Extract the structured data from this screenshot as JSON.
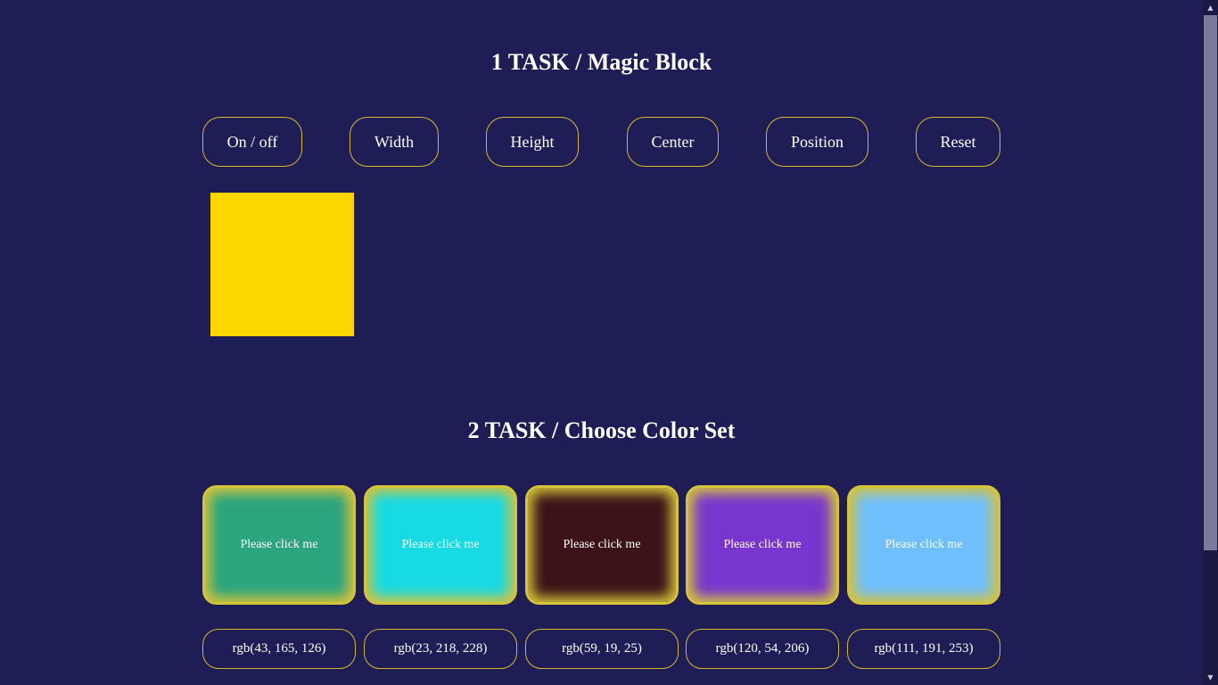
{
  "task1": {
    "title": "1 TASK / Magic Block",
    "buttons": [
      {
        "label": "On / off"
      },
      {
        "label": "Width"
      },
      {
        "label": "Height"
      },
      {
        "label": "Center"
      },
      {
        "label": "Position"
      },
      {
        "label": "Reset"
      }
    ],
    "block_color": "#ffd700"
  },
  "task2": {
    "title": "2 TASK / Choose Color Set",
    "cards": [
      {
        "label": "Please click me",
        "color": "rgb(43, 165, 126)",
        "rgb_text": "rgb(43, 165, 126)"
      },
      {
        "label": "Please click me",
        "color": "rgb(23, 218, 228)",
        "rgb_text": "rgb(23, 218, 228)"
      },
      {
        "label": "Please click me",
        "color": "rgb(59, 19, 25)",
        "rgb_text": "rgb(59, 19, 25)"
      },
      {
        "label": "Please click me",
        "color": "rgb(120, 54, 206)",
        "rgb_text": "rgb(120, 54, 206)"
      },
      {
        "label": "Please click me",
        "color": "rgb(111, 191, 253)",
        "rgb_text": "rgb(111, 191, 253)"
      }
    ]
  },
  "theme": {
    "background": "#1f1d55",
    "accent_border": "#d9b82a",
    "glow": "#d5c33a"
  },
  "scrollbar": {
    "up_icon": "scroll-up-arrow-icon",
    "down_icon": "scroll-down-arrow-icon"
  }
}
